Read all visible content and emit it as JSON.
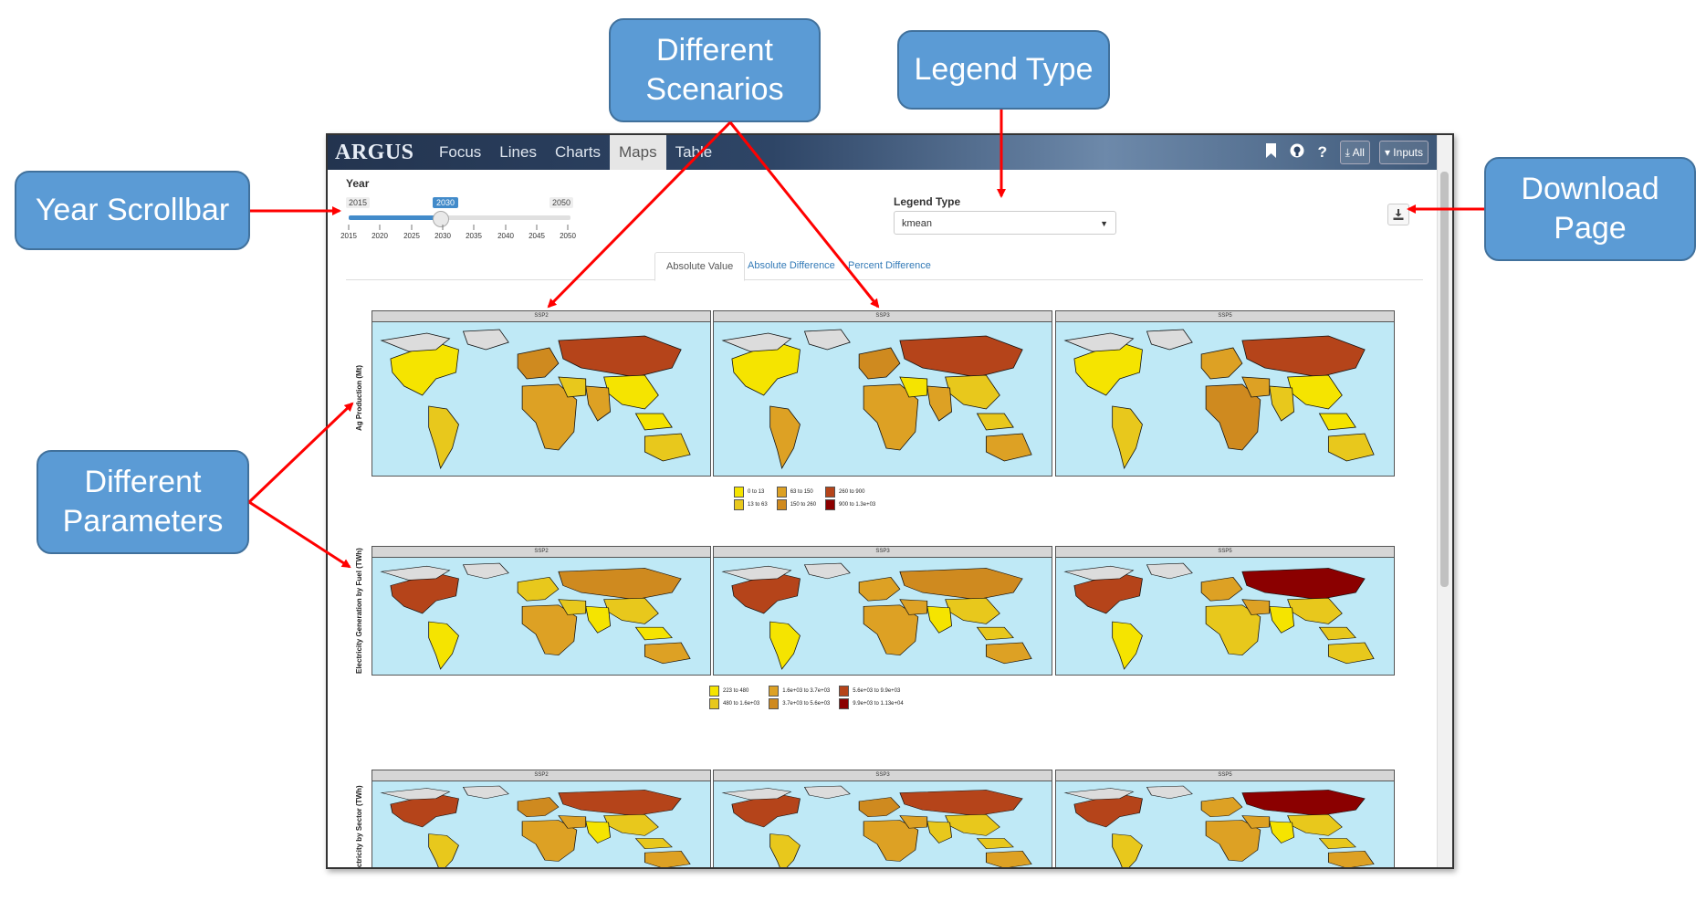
{
  "callouts": {
    "scenarios": "Different\nScenarios",
    "legend_type": "Legend Type",
    "year_scrollbar": "Year Scrollbar",
    "download_page": "Download\nPage",
    "parameters": "Different\nParameters"
  },
  "colors": {
    "callout_fill": "#5b9bd5",
    "arrow": "#ff0000",
    "ocean": "#bfe9f6",
    "no_data": "#dcdcdc",
    "nav_bg": "#2e4566",
    "accent": "#428bca"
  },
  "navbar": {
    "brand": "ARGUS",
    "items": [
      "Focus",
      "Lines",
      "Charts",
      "Maps",
      "Table"
    ],
    "active": "Maps",
    "icons": [
      "bookmark-icon",
      "github-icon",
      "help-icon"
    ],
    "all_button": "⤓ All",
    "inputs_button": "▾ Inputs"
  },
  "year": {
    "label": "Year",
    "min": "2015",
    "max": "2050",
    "value": "2030",
    "ticks": [
      "2015",
      "2020",
      "2025",
      "2030",
      "2035",
      "2040",
      "2045",
      "2050"
    ]
  },
  "legend_type": {
    "label": "Legend Type",
    "value": "kmean"
  },
  "download": {
    "icon": "download-icon"
  },
  "tabs": [
    "Absolute Value",
    "Absolute Difference",
    "Percent Difference"
  ],
  "active_tab": "Absolute Value",
  "rows": [
    {
      "parameter": "Ag Production (Mt)",
      "scenarios": [
        "SSP2",
        "SSP3",
        "SSP5"
      ],
      "legend": [
        "0 to 13",
        "13 to 63",
        "63 to 150",
        "150 to 260",
        "260 to 900",
        "900 to 1.3e+03"
      ]
    },
    {
      "parameter": "Electricity Generation by Fuel (TWh)",
      "scenarios": [
        "SSP2",
        "SSP3",
        "SSP5"
      ],
      "legend": [
        "223 to 480",
        "480 to 1.6e+03",
        "1.6e+03 to 3.7e+03",
        "3.7e+03 to 5.6e+03",
        "5.6e+03 to 9.9e+03",
        "9.9e+03 to 1.13e+04"
      ]
    },
    {
      "parameter": "ectricity by Sector (TWh)",
      "scenarios": [
        "SSP2",
        "SSP3",
        "SSP5"
      ],
      "legend": []
    }
  ],
  "legend_palette": [
    "#f5e400",
    "#e8c81c",
    "#dda124",
    "#cf8a1f",
    "#b5441a",
    "#8b0000"
  ]
}
